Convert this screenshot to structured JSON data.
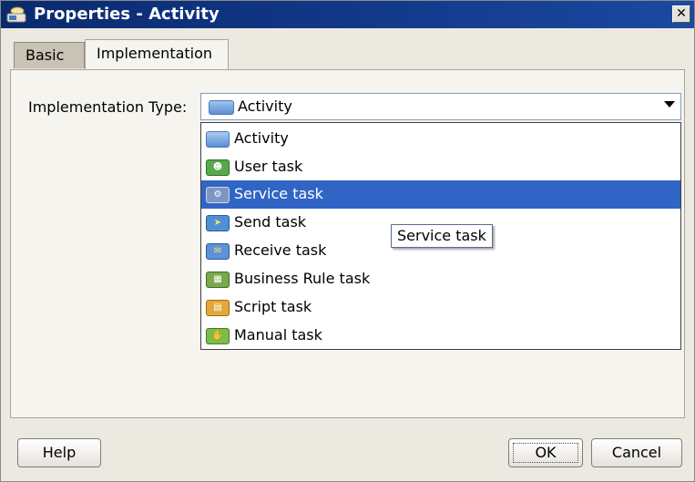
{
  "window": {
    "title": "Properties - Activity",
    "close_label": "✕"
  },
  "tabs": [
    {
      "label": "Basic"
    },
    {
      "label": "Implementation"
    }
  ],
  "form": {
    "implementation_type_label": "Implementation Type:",
    "selected_value": "Activity"
  },
  "dropdown": {
    "items": [
      {
        "label": "Activity",
        "icon": "activity-icon",
        "color": "#6fa3e6"
      },
      {
        "label": "User task",
        "icon": "user-task-icon",
        "color": "#58a84c"
      },
      {
        "label": "Service task",
        "icon": "service-task-icon",
        "color": "#7d97c4"
      },
      {
        "label": "Send task",
        "icon": "send-task-icon",
        "color": "#4f8fd6"
      },
      {
        "label": "Receive task",
        "icon": "receive-task-icon",
        "color": "#5c93d8"
      },
      {
        "label": "Business Rule task",
        "icon": "business-rule-task-icon",
        "color": "#7aa84a"
      },
      {
        "label": "Script task",
        "icon": "script-task-icon",
        "color": "#e2a93a"
      },
      {
        "label": "Manual task",
        "icon": "manual-task-icon",
        "color": "#7fbb48"
      }
    ],
    "highlighted": "Service task"
  },
  "tooltip": {
    "text": "Service task"
  },
  "buttons": {
    "help": "Help",
    "ok": "OK",
    "cancel": "Cancel"
  },
  "colors": {
    "selection": "#3165c5",
    "titlebar": "#0a2a6e"
  }
}
